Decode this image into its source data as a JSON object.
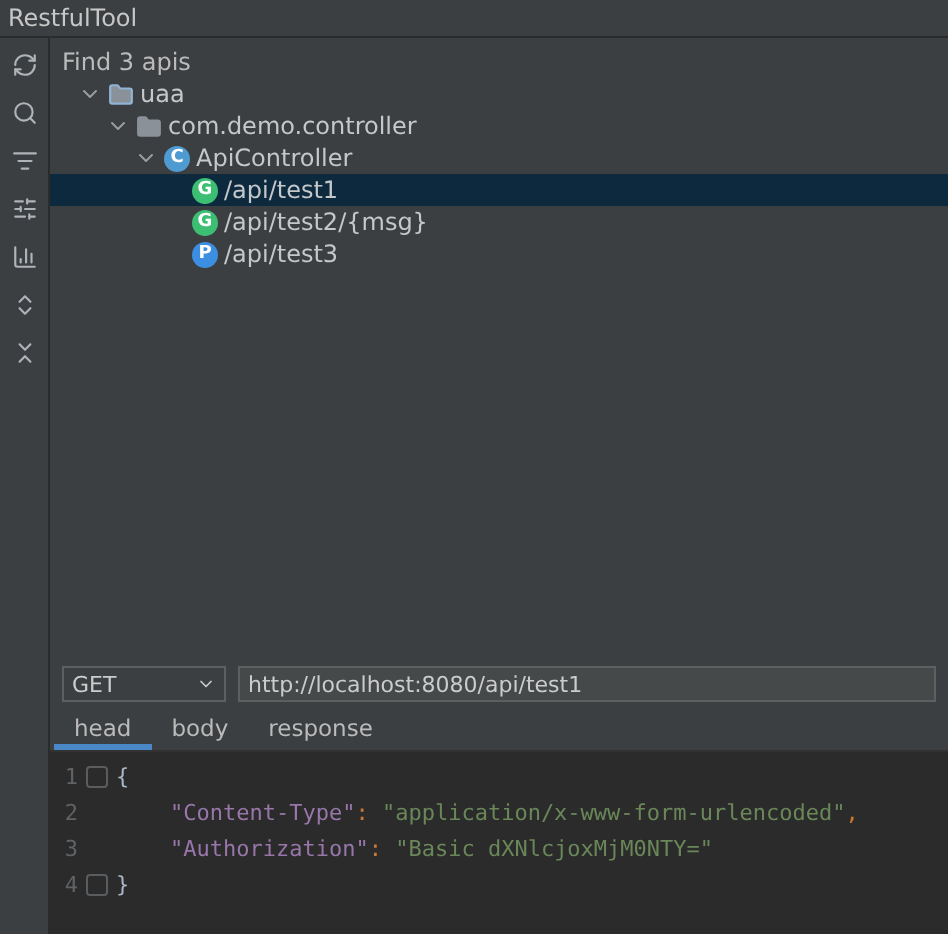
{
  "window": {
    "title": "RestfulTool"
  },
  "toolbar": {
    "items": [
      {
        "kind": "refresh"
      },
      {
        "kind": "search"
      },
      {
        "kind": "filter"
      },
      {
        "kind": "sliders"
      },
      {
        "kind": "bars"
      },
      {
        "kind": "expand"
      },
      {
        "kind": "collapse"
      }
    ]
  },
  "tree": {
    "header": "Find 3 apis",
    "items": [
      {
        "kind": "module",
        "label": "uaa",
        "expanded": true,
        "selected": false,
        "children": [
          {
            "kind": "package",
            "label": "com.demo.controller",
            "expanded": true,
            "selected": false,
            "children": [
              {
                "kind": "class",
                "badge": "C",
                "color": "#4d9bd1",
                "label": "ApiController",
                "expanded": true,
                "selected": false,
                "children": [
                  {
                    "kind": "method",
                    "badge": "G",
                    "color": "#3dbf73",
                    "label": "/api/test1",
                    "selected": true
                  },
                  {
                    "kind": "method",
                    "badge": "G",
                    "color": "#3dbf73",
                    "label": "/api/test2/{msg}",
                    "selected": false
                  },
                  {
                    "kind": "method",
                    "badge": "P",
                    "color": "#3c8fe0",
                    "label": "/api/test3",
                    "selected": false
                  }
                ]
              }
            ]
          }
        ]
      }
    ]
  },
  "request": {
    "method": "GET",
    "url": "http://localhost:8080/api/test1"
  },
  "tabs": [
    {
      "label": "head",
      "selected": true
    },
    {
      "label": "body",
      "selected": false
    },
    {
      "label": "response",
      "selected": false
    }
  ],
  "editor": {
    "lines": [
      {
        "number": "1",
        "kind": "brace",
        "fold": true,
        "tokens": [
          {
            "kind": "brace",
            "text": "{"
          }
        ]
      },
      {
        "number": "2",
        "kind": "member",
        "fold": false,
        "tokens": [
          {
            "kind": "key",
            "text": "\"Content-Type\""
          },
          {
            "kind": "punct",
            "text": ": "
          },
          {
            "kind": "string",
            "text": "\"application/x-www-form-urlencoded\""
          },
          {
            "kind": "punct",
            "text": ","
          }
        ]
      },
      {
        "number": "3",
        "kind": "member",
        "fold": false,
        "tokens": [
          {
            "kind": "key",
            "text": "\"Authorization\""
          },
          {
            "kind": "punct",
            "text": ": "
          },
          {
            "kind": "string",
            "text": "\"Basic dXNlcjoxMjM0NTY=\""
          }
        ]
      },
      {
        "number": "4",
        "kind": "brace",
        "fold": true,
        "tokens": [
          {
            "kind": "brace",
            "text": "}"
          }
        ]
      }
    ]
  }
}
